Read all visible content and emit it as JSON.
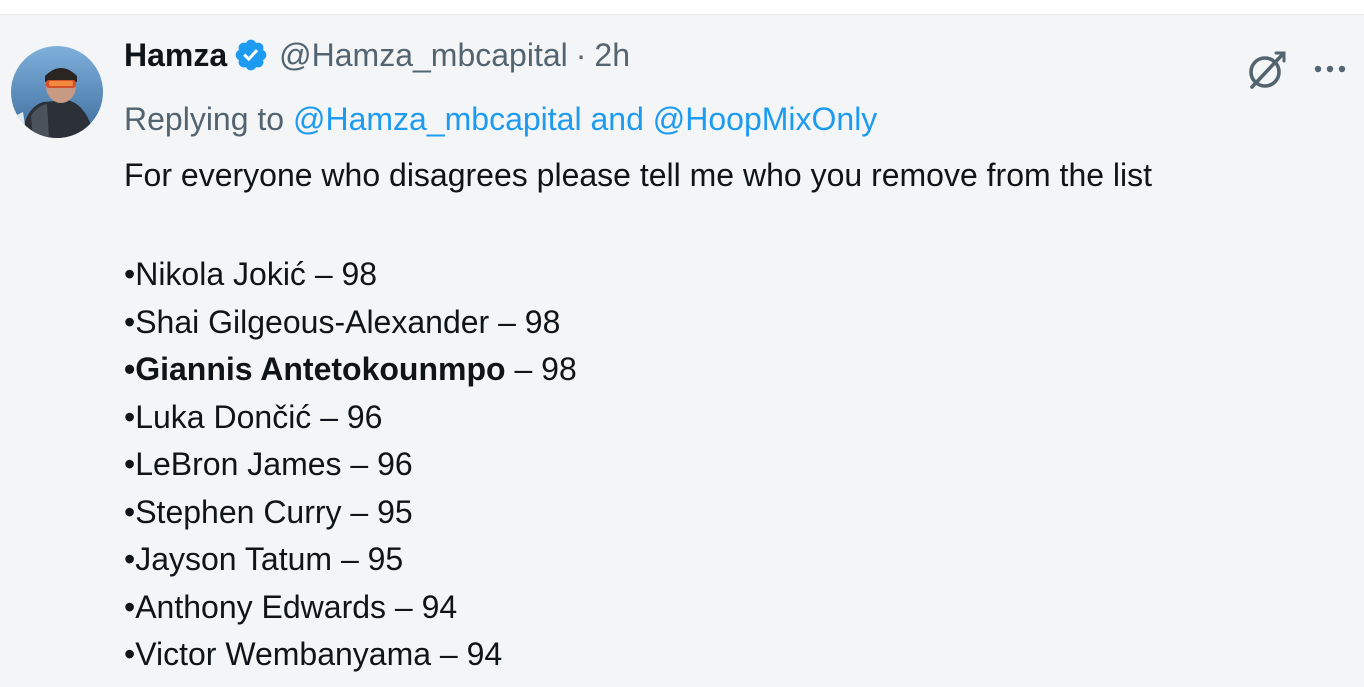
{
  "tweet": {
    "author": {
      "name": "Hamza",
      "verified": true,
      "handle": "@Hamza_mbcapital",
      "separator": "·",
      "time": "2h"
    },
    "reply": {
      "prefix": "Replying to ",
      "user1": "@Hamza_mbcapital",
      "and": " and ",
      "user2": "@HoopMixOnly"
    },
    "text": "For everyone who disagrees please tell me who you remove from the list",
    "list": [
      {
        "bullet": "•",
        "name": "Nikola Jokić",
        "rating": " – 98",
        "bold": false
      },
      {
        "bullet": "•",
        "name": "Shai Gilgeous-Alexander",
        "rating": " – 98",
        "bold": false
      },
      {
        "bullet": "•",
        "name": "Giannis Antetokounmpo",
        "rating": " – 98",
        "bold": true
      },
      {
        "bullet": "•",
        "name": "Luka Dončić",
        "rating": " – 96",
        "bold": false
      },
      {
        "bullet": "•",
        "name": "LeBron James",
        "rating": " – 96",
        "bold": false
      },
      {
        "bullet": "•",
        "name": "Stephen Curry",
        "rating": " – 95",
        "bold": false
      },
      {
        "bullet": "•",
        "name": "Jayson Tatum",
        "rating": " – 95",
        "bold": false
      },
      {
        "bullet": "•",
        "name": "Anthony Edwards",
        "rating": " – 94",
        "bold": false
      },
      {
        "bullet": "•",
        "name": "Victor Wembanyama",
        "rating": " – 94",
        "bold": false
      }
    ]
  },
  "icons": {
    "verified": "verified-badge-icon",
    "grok": "grok-icon",
    "more": "more-icon"
  },
  "colors": {
    "link": "#1d9bf0",
    "muted": "#536471",
    "text": "#0f1419",
    "background": "#f4f5f7"
  }
}
